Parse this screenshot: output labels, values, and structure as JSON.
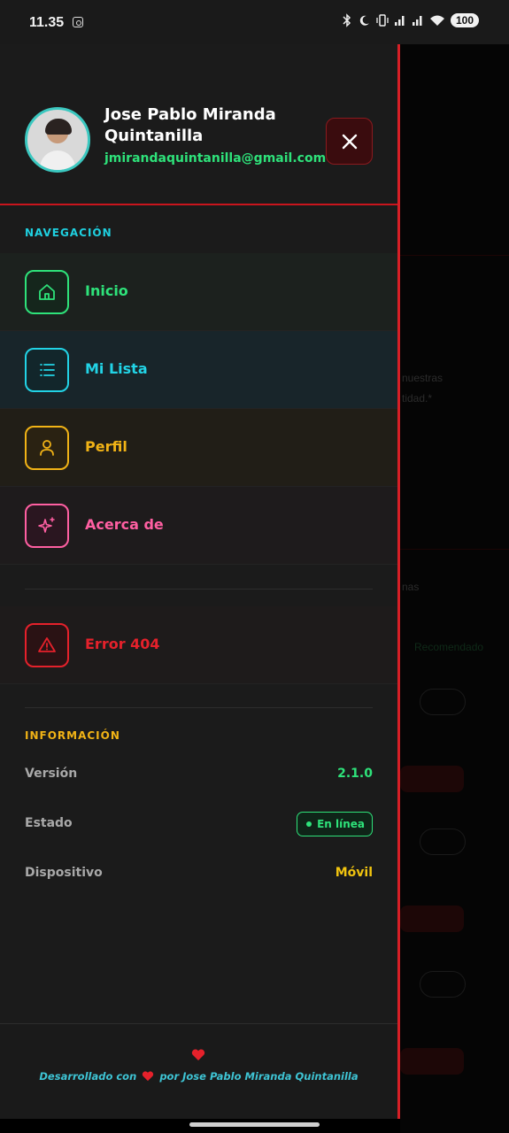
{
  "status_bar": {
    "time": "11.35",
    "battery": "100"
  },
  "user": {
    "name": "Jose Pablo Miranda Quintanilla",
    "email": "jmirandaquintanilla@gmail.com"
  },
  "navigation": {
    "title": "NAVEGACIÓN",
    "items": [
      {
        "label": "Inicio",
        "icon": "home-icon",
        "color": "#2ee27a"
      },
      {
        "label": "Mi Lista",
        "icon": "list-icon",
        "color": "#22d3e6"
      },
      {
        "label": "Perfil",
        "icon": "user-icon",
        "color": "#f1b316"
      },
      {
        "label": "Acerca de",
        "icon": "sparkles-icon",
        "color": "#ff5fa2"
      }
    ],
    "error_item": {
      "label": "Error 404",
      "icon": "alert-triangle-icon",
      "color": "#e5212b"
    }
  },
  "info": {
    "title": "INFORMACIÓN",
    "version_label": "Versión",
    "version_value": "2.1.0",
    "status_label": "Estado",
    "status_value": "En línea",
    "device_label": "Dispositivo",
    "device_value": "Móvil"
  },
  "footer": {
    "prefix": "Desarrollado con",
    "suffix": "por Jose Pablo Miranda Quintanilla"
  },
  "colors": {
    "accent_red": "#d61f26",
    "green": "#2ee27a",
    "cyan": "#22d3e6",
    "yellow": "#f1b316",
    "pink": "#ff5fa2"
  }
}
